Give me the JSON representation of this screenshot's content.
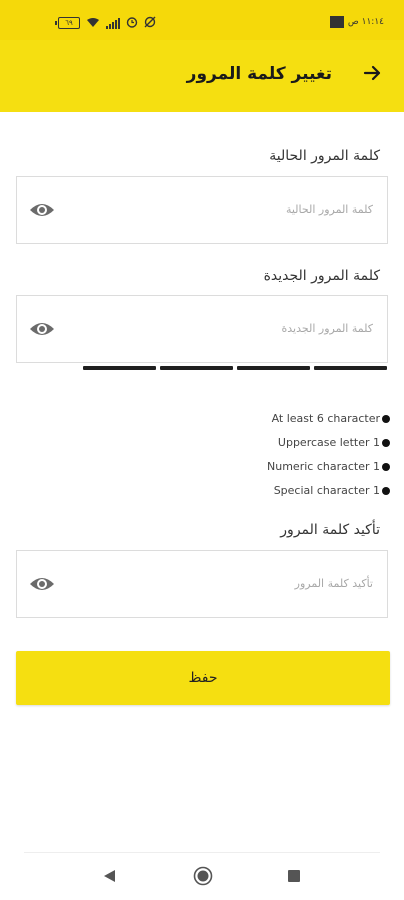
{
  "status_bar": {
    "time": "١١:١٤ ص",
    "battery": "٦٩"
  },
  "header": {
    "title": "تغيير كلمة المرور",
    "back_icon": "arrow-right-icon"
  },
  "form": {
    "current_password": {
      "label": "كلمة المرور الحالية",
      "placeholder": "كلمة المرور الحالية",
      "value": ""
    },
    "new_password": {
      "label": "كلمة المرور الجديدة",
      "placeholder": "كلمة المرور الجديدة",
      "value": ""
    },
    "confirm_password": {
      "label": "تأكيد كلمة المرور",
      "placeholder": "تأكيد كلمة المرور",
      "value": ""
    },
    "eye_icon": "eye-icon",
    "strength_segments": 4
  },
  "requirements": [
    "At least 6 character",
    "Uppercase letter 1",
    "Numeric character 1",
    "Special character 1"
  ],
  "actions": {
    "save_label": "حفظ"
  },
  "colors": {
    "accent": "#f5df11",
    "border": "#dcdcdc",
    "strength_bar": "#1f1f1f"
  }
}
